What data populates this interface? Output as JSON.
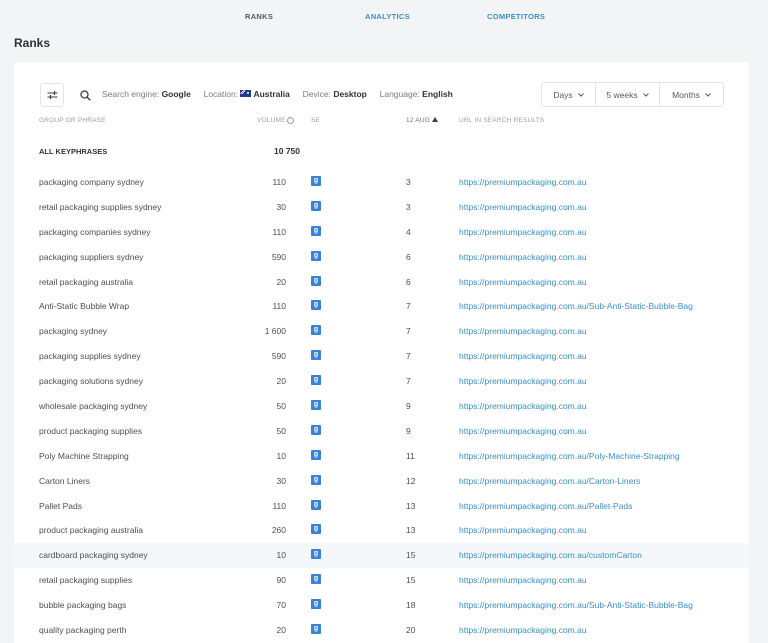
{
  "nav": {
    "tabs": [
      "RANKS",
      "ANALYTICS",
      "COMPETITORS"
    ]
  },
  "page": {
    "title": "Ranks"
  },
  "toolbar": {
    "search_engine_label": "Search engine:",
    "search_engine": "Google",
    "location_label": "Location:",
    "location": "Australia",
    "device_label": "Device:",
    "device": "Desktop",
    "language_label": "Language:",
    "language": "English",
    "periods": [
      "Days",
      "5 weeks",
      "Months"
    ]
  },
  "table": {
    "headers": {
      "phrase": "GROUP OR PHRASE",
      "volume": "VOLUME",
      "se": "SE",
      "date": "12 AUG",
      "url": "URL IN SEARCH RESULTS"
    },
    "all": {
      "label": "ALL KEYPHRASES",
      "volume": "10 750"
    },
    "se_glyph": "g",
    "rows": [
      {
        "phrase": "packaging company sydney",
        "volume": "110",
        "rank": "3",
        "url": "https://premiumpackaging.com.au"
      },
      {
        "phrase": "retail packaging supplies sydney",
        "volume": "30",
        "rank": "3",
        "url": "https://premiumpackaging.com.au"
      },
      {
        "phrase": "packaging companies sydney",
        "volume": "110",
        "rank": "4",
        "url": "https://premiumpackaging.com.au"
      },
      {
        "phrase": "packaging suppliers sydney",
        "volume": "590",
        "rank": "6",
        "url": "https://premiumpackaging.com.au"
      },
      {
        "phrase": "retail packaging australia",
        "volume": "20",
        "rank": "6",
        "url": "https://premiumpackaging.com.au"
      },
      {
        "phrase": "Anti-Static Bubble Wrap",
        "volume": "110",
        "rank": "7",
        "url": "https://premiumpackaging.com.au/Sub-Anti-Static-Bubble-Bag"
      },
      {
        "phrase": "packaging sydney",
        "volume": "1 600",
        "rank": "7",
        "url": "https://premiumpackaging.com.au"
      },
      {
        "phrase": "packaging supplies sydney",
        "volume": "590",
        "rank": "7",
        "url": "https://premiumpackaging.com.au"
      },
      {
        "phrase": "packaging solutions sydney",
        "volume": "20",
        "rank": "7",
        "url": "https://premiumpackaging.com.au"
      },
      {
        "phrase": "wholesale packaging sydney",
        "volume": "50",
        "rank": "9",
        "url": "https://premiumpackaging.com.au"
      },
      {
        "phrase": "product packaging supplies",
        "volume": "50",
        "rank": "9",
        "url": "https://premiumpackaging.com.au"
      },
      {
        "phrase": "Poly Machine Strapping",
        "volume": "10",
        "rank": "11",
        "url": "https://premiumpackaging.com.au/Poly-Machine-Strapping"
      },
      {
        "phrase": "Carton Liners",
        "volume": "30",
        "rank": "12",
        "url": "https://premiumpackaging.com.au/Carton-Liners"
      },
      {
        "phrase": "Pallet Pads",
        "volume": "110",
        "rank": "13",
        "url": "https://premiumpackaging.com.au/Pallet-Pads"
      },
      {
        "phrase": "product packaging australia",
        "volume": "260",
        "rank": "13",
        "url": "https://premiumpackaging.com.au"
      },
      {
        "phrase": "cardboard packaging sydney",
        "volume": "10",
        "rank": "15",
        "url": "https://premiumpackaging.com.au/customCarton",
        "highlighted": true
      },
      {
        "phrase": "retail packaging supplies",
        "volume": "90",
        "rank": "15",
        "url": "https://premiumpackaging.com.au"
      },
      {
        "phrase": "bubble packaging bags",
        "volume": "70",
        "rank": "18",
        "url": "https://premiumpackaging.com.au/Sub-Anti-Static-Bubble-Bag"
      },
      {
        "phrase": "quality packaging perth",
        "volume": "20",
        "rank": "20",
        "url": "https://premiumpackaging.com.au"
      }
    ]
  },
  "colors": {
    "accent": "#3a8fc9",
    "se_badge": "#3a82d6",
    "background": "#f3f4f6"
  }
}
